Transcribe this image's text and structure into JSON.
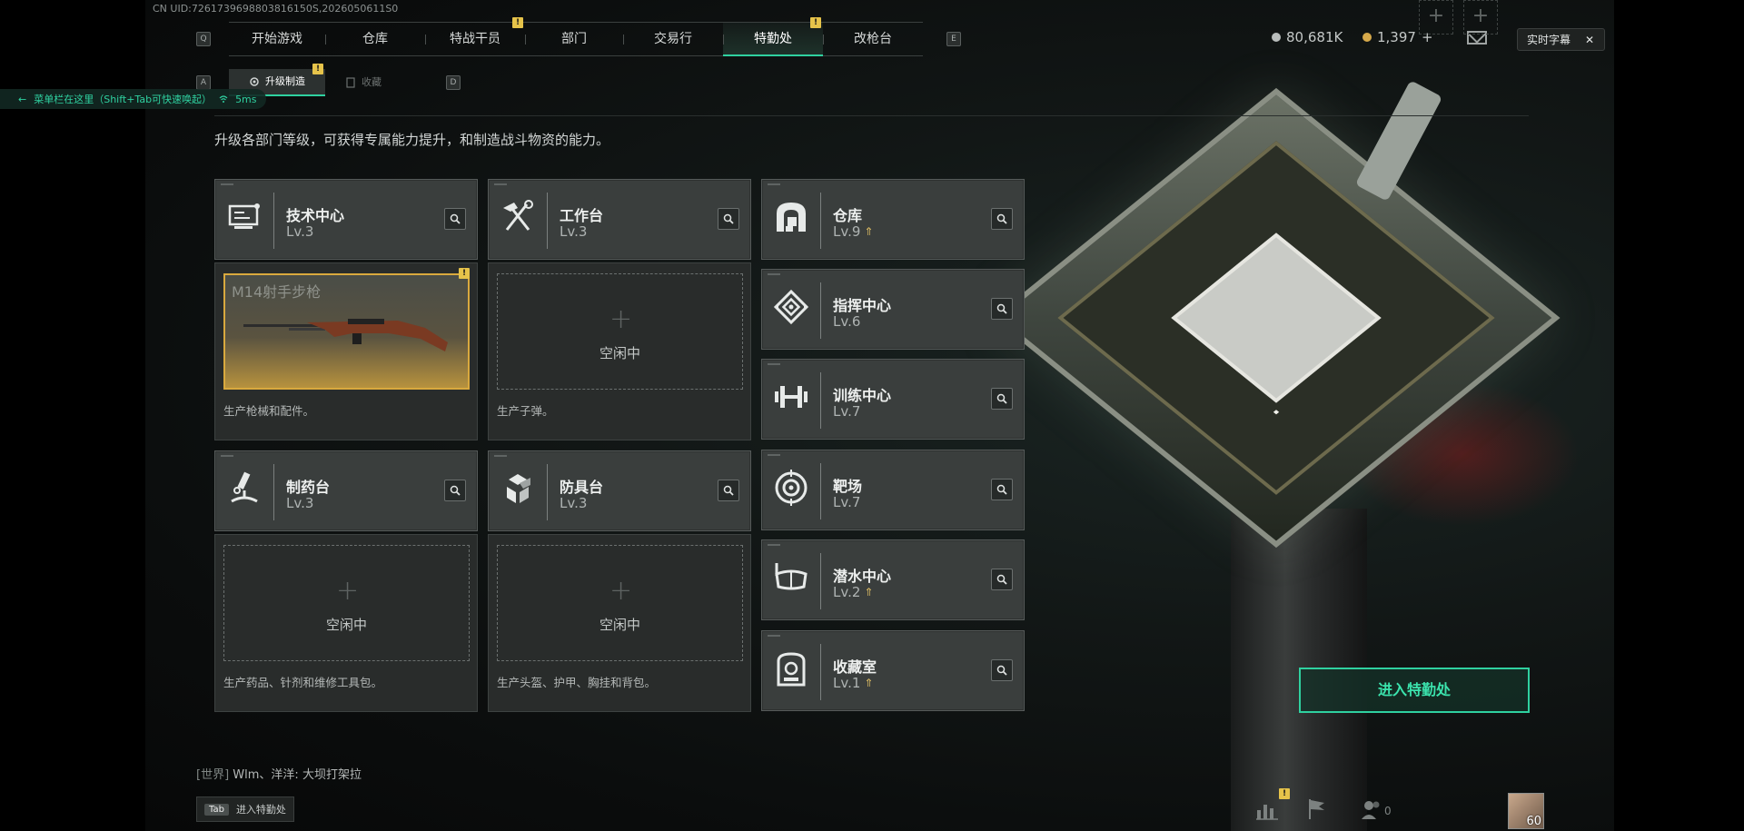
{
  "uid": "CN UID:7261739698803816150S,2026050611S0",
  "top_tabs": [
    {
      "label": "开始游戏",
      "notif": false
    },
    {
      "label": "仓库",
      "notif": false
    },
    {
      "label": "特战干员",
      "notif": true
    },
    {
      "label": "部门",
      "notif": false
    },
    {
      "label": "交易行",
      "notif": false
    },
    {
      "label": "特勤处",
      "notif": true,
      "active": true
    },
    {
      "label": "改枪台",
      "notif": false
    }
  ],
  "keys": {
    "q": "Q",
    "e": "E",
    "a": "A",
    "d": "D"
  },
  "sub_tabs": [
    {
      "label": "升级制造",
      "active": true,
      "notif": true
    },
    {
      "label": "收藏",
      "active": false,
      "notif": false
    }
  ],
  "hint": {
    "text": "菜单栏在这里（Shift+Tab可快速唤起）",
    "ping": "5ms"
  },
  "currency": [
    {
      "value": "80,681K",
      "color": "#b9bdbc"
    },
    {
      "value": "1,397",
      "color": "#d6a94a",
      "plus": "+"
    }
  ],
  "subtitle_btn": {
    "label": "实时字幕",
    "close": "✕"
  },
  "description": "升级各部门等级，可获得专属能力提升，和制造战斗物资的能力。",
  "workshops": [
    {
      "name": "技术中心",
      "lv": "Lv.3",
      "icon": "tech-center-icon",
      "panel": {
        "state": "busy",
        "item": "M14射手步枪",
        "desc": "生产枪械和配件。"
      }
    },
    {
      "name": "工作台",
      "lv": "Lv.3",
      "icon": "workbench-icon",
      "panel": {
        "state": "idle",
        "idle_text": "空闲中",
        "desc": "生产子弹。"
      }
    },
    {
      "name": "制药台",
      "lv": "Lv.3",
      "icon": "pharmacy-icon",
      "panel": {
        "state": "idle",
        "idle_text": "空闲中",
        "desc": "生产药品、针剂和维修工具包。"
      }
    },
    {
      "name": "防具台",
      "lv": "Lv.3",
      "icon": "armor-bench-icon",
      "panel": {
        "state": "idle",
        "idle_text": "空闲中",
        "desc": "生产头盔、护甲、胸挂和背包。"
      }
    }
  ],
  "departments": [
    {
      "name": "仓库",
      "lv": "Lv.9",
      "upgrade": true,
      "icon": "storage-icon"
    },
    {
      "name": "指挥中心",
      "lv": "Lv.6",
      "upgrade": false,
      "icon": "command-center-icon"
    },
    {
      "name": "训练中心",
      "lv": "Lv.7",
      "upgrade": false,
      "icon": "training-center-icon"
    },
    {
      "name": "靶场",
      "lv": "Lv.7",
      "upgrade": false,
      "icon": "shooting-range-icon"
    },
    {
      "name": "潜水中心",
      "lv": "Lv.2",
      "upgrade": true,
      "icon": "diving-center-icon"
    },
    {
      "name": "收藏室",
      "lv": "Lv.1",
      "upgrade": true,
      "icon": "collection-room-icon"
    }
  ],
  "enter_button": "进入特勤处",
  "chat": {
    "channel": "[世界]",
    "message": "Wlm、洋洋: 大坝打架拉"
  },
  "tab_hint": {
    "key": "Tab",
    "label": "进入特勤处"
  },
  "bottom": {
    "friends_count": "0",
    "level": "60",
    "plus": "+"
  }
}
